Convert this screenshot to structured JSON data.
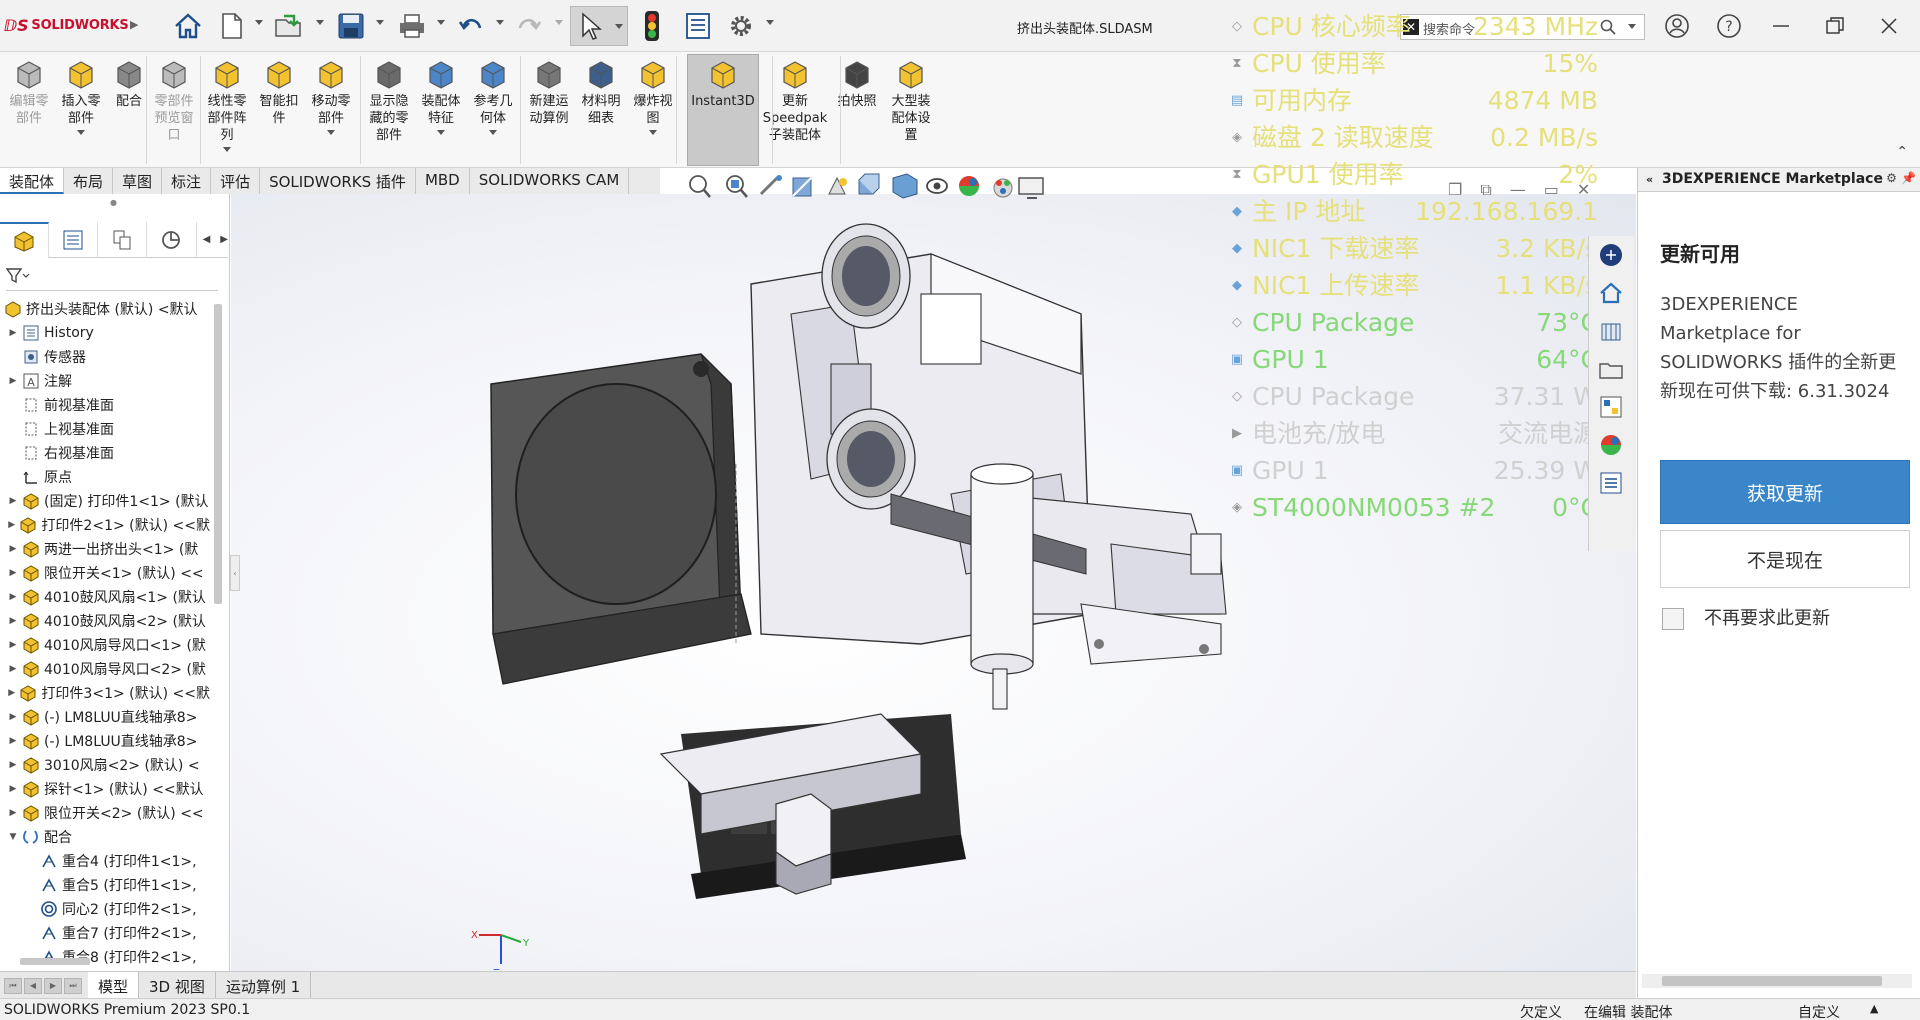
{
  "app": {
    "brand": "SOLIDWORKS",
    "document_title": "挤出头装配体.SLDASM"
  },
  "search": {
    "placeholder": "搜索命令"
  },
  "ribbon": [
    {
      "label": "编辑零\n部件",
      "disabled": true
    },
    {
      "label": "插入零\n部件"
    },
    {
      "label": "配合"
    },
    {
      "label": "零部件\n预览窗\n口",
      "disabled": true
    },
    {
      "label": "线性零\n部件阵\n列"
    },
    {
      "label": "智能扣\n件"
    },
    {
      "label": "移动零\n部件"
    },
    {
      "label": "显示隐\n藏的零\n部件"
    },
    {
      "label": "装配体\n特征"
    },
    {
      "label": "参考几\n何体"
    },
    {
      "label": "新建运\n动算例"
    },
    {
      "label": "材料明\n细表"
    },
    {
      "label": "爆炸视\n图"
    },
    {
      "label": "Instant3D"
    },
    {
      "label": "更新\nSpeedpak\n子装配体"
    },
    {
      "label": "拍快照"
    },
    {
      "label": "大型装\n配体设\n置"
    }
  ],
  "tabs": [
    "装配体",
    "布局",
    "草图",
    "标注",
    "评估",
    "SOLIDWORKS 插件",
    "MBD",
    "SOLIDWORKS CAM"
  ],
  "tree": [
    {
      "label": "挤出头装配体 (默认) <默认",
      "level": 0,
      "icon": "assembly"
    },
    {
      "label": "History",
      "level": 1,
      "icon": "history",
      "exp": true
    },
    {
      "label": "传感器",
      "level": 1,
      "icon": "sensor"
    },
    {
      "label": "注解",
      "level": 1,
      "icon": "annotation",
      "exp": true
    },
    {
      "label": "前视基准面",
      "level": 1,
      "icon": "plane"
    },
    {
      "label": "上视基准面",
      "level": 1,
      "icon": "plane"
    },
    {
      "label": "右视基准面",
      "level": 1,
      "icon": "plane"
    },
    {
      "label": "原点",
      "level": 1,
      "icon": "origin"
    },
    {
      "label": "(固定) 打印件1<1> (默认",
      "level": 1,
      "icon": "part",
      "exp": true
    },
    {
      "label": "打印件2<1> (默认) <<默",
      "level": 1,
      "icon": "part",
      "exp": true
    },
    {
      "label": "两进一出挤出头<1> (默",
      "level": 1,
      "icon": "part",
      "exp": true
    },
    {
      "label": "限位开关<1> (默认) <<",
      "level": 1,
      "icon": "part",
      "exp": true
    },
    {
      "label": "4010鼓风风扇<1> (默认",
      "level": 1,
      "icon": "part",
      "exp": true
    },
    {
      "label": "4010鼓风风扇<2> (默认",
      "level": 1,
      "icon": "part",
      "exp": true
    },
    {
      "label": "4010风扇导风口<1> (默",
      "level": 1,
      "icon": "part",
      "exp": true
    },
    {
      "label": "4010风扇导风口<2> (默",
      "level": 1,
      "icon": "part",
      "exp": true
    },
    {
      "label": "打印件3<1> (默认) <<默",
      "level": 1,
      "icon": "part",
      "exp": true
    },
    {
      "label": "(-) LM8LUU直线轴承8>",
      "level": 1,
      "icon": "part",
      "exp": true
    },
    {
      "label": "(-) LM8LUU直线轴承8>",
      "level": 1,
      "icon": "part",
      "exp": true
    },
    {
      "label": "3010风扇<2> (默认) <",
      "level": 1,
      "icon": "part",
      "exp": true
    },
    {
      "label": "探针<1> (默认) <<默认",
      "level": 1,
      "icon": "part",
      "exp": true
    },
    {
      "label": "限位开关<2> (默认) <<",
      "level": 1,
      "icon": "part",
      "exp": true
    },
    {
      "label": "配合",
      "level": 1,
      "icon": "mates",
      "exp": true,
      "open": true
    },
    {
      "label": "重合4 (打印件1<1>,",
      "level": 2,
      "icon": "coincident"
    },
    {
      "label": "重合5 (打印件1<1>,",
      "level": 2,
      "icon": "coincident"
    },
    {
      "label": "同心2 (打印件2<1>,",
      "level": 2,
      "icon": "concentric"
    },
    {
      "label": "重合7 (打印件2<1>,",
      "level": 2,
      "icon": "coincident"
    },
    {
      "label": "重合8 (打印件2<1>,",
      "level": 2,
      "icon": "coincident"
    }
  ],
  "hud": [
    {
      "icon": "chip",
      "label": "CPU 核心频率",
      "value": "2343 MHz",
      "color": "#e6e07a"
    },
    {
      "icon": "hourglass",
      "label": "CPU 使用率",
      "value": "15%",
      "color": "#e6e07a"
    },
    {
      "icon": "memory",
      "label": "可用内存",
      "value": "4874 MB",
      "color": "#e6e07a"
    },
    {
      "icon": "disk",
      "label": "磁盘 2 读取速度",
      "value": "0.2 MB/s",
      "color": "#e6e07a"
    },
    {
      "icon": "hourglass",
      "label": "GPU1 使用率",
      "value": "2%",
      "color": "#e6e07a"
    },
    {
      "icon": "network",
      "label": "主 IP 地址",
      "value": "192.168.169.1",
      "color": "#e6e07a"
    },
    {
      "icon": "network",
      "label": "NIC1 下载速率",
      "value": "3.2 KB/s",
      "color": "#e6e07a"
    },
    {
      "icon": "network",
      "label": "NIC1 上传速率",
      "value": "1.1 KB/s",
      "color": "#e6e07a"
    },
    {
      "icon": "chip",
      "label": "CPU Package",
      "value": "73°C",
      "color": "#86d878"
    },
    {
      "icon": "gpu",
      "label": "GPU 1",
      "value": "64°C",
      "color": "#86d878"
    },
    {
      "icon": "chip",
      "label": "CPU Package",
      "value": "37.31 W",
      "color": "#d0d0d0"
    },
    {
      "icon": "battery",
      "label": "电池充/放电",
      "value": "交流电源",
      "color": "#d0d0d0"
    },
    {
      "icon": "gpu",
      "label": "GPU 1",
      "value": "25.39 W",
      "color": "#d0d0d0"
    },
    {
      "icon": "disk",
      "label": "ST4000NM0053 #2",
      "value": "0°C",
      "color": "#86d878"
    }
  ],
  "right_panel": {
    "header": "3DEXPERIENCE Marketplace",
    "title": "更新可用",
    "body": "3DEXPERIENCE Marketplace for SOLIDWORKS 插件的全新更新现在可供下载: 6.31.3024",
    "primary_button": "获取更新",
    "secondary_button": "不是现在",
    "checkbox_label": "不再要求此更新",
    "checkbox_checked": false
  },
  "bottom_tabs": [
    "模型",
    "3D 视图",
    "运动算例 1"
  ],
  "status": {
    "product": "SOLIDWORKS Premium 2023 SP0.1",
    "units": "欠定义",
    "mode": "在编辑 装配体",
    "custom": "自定义"
  },
  "triad": {
    "x": "X",
    "y": "Y",
    "z": "Z"
  },
  "colors": {
    "accent": "#2b6fb6",
    "primary_button": "#3a86c8",
    "brand": "#c8102e"
  }
}
